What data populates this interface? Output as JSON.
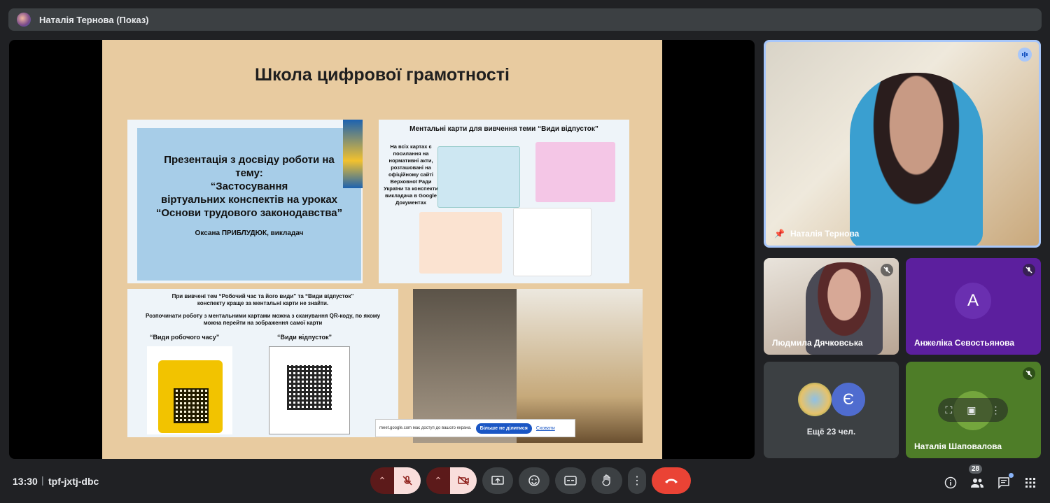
{
  "top_bar": {
    "presenter_label": "Наталія Тернова (Показ)"
  },
  "slide": {
    "title": "Школа цифрової грамотності",
    "panel1": {
      "lines": [
        "Презентація з досвіду  роботи на",
        "тему:",
        "“Застосування",
        "віртуальних конспектів на уроках",
        "“Основи трудового законодавства”"
      ],
      "author": "Оксана ПРИБЛУДЮК, викладач"
    },
    "panel2": {
      "heading": "Ментальні карти для вивчення теми “Види відпусток”",
      "note": "На всіх картах є посилання на нормативні акти, розташовані на офіційному сайті Верховної Ради України  та конспекти викладача в Google Документах"
    },
    "panel3": {
      "line1": "При вивчені тем “Робочий час та його види” та “Види відпусток”",
      "line2": "конспекту краще за ментальні карти не знайти.",
      "line3": "Розпочинати роботу з ментальними картами можна з сканування QR-коду, по якому",
      "line4": "можна перейти на зображення самої карти",
      "label_left": "“Види робочого часу”",
      "label_right": "“Види відпусток”"
    },
    "share_banner": {
      "text": "meet.google.com має доступ до вашого екрана.",
      "stop_button": "Більше не ділитися",
      "hide_link": "Сховати"
    }
  },
  "participants": {
    "main": {
      "name": "Наталія Тернова"
    },
    "tile2": {
      "name": "Людмила Дячковська"
    },
    "tile3": {
      "name": "Анжеліка Севостьянова",
      "initial": "А"
    },
    "tile4": {
      "more": "Ещё 23 чел.",
      "initial": "Є"
    },
    "tile5": {
      "name": "Наталія Шаповалова"
    }
  },
  "bottom_bar": {
    "time": "13:30",
    "separator": "|",
    "meeting_code": "tpf-jxtj-dbc",
    "participants_count": "28"
  },
  "colors": {
    "hangup": "#ea4335",
    "active_border": "#a8c7fa",
    "background": "#202124"
  }
}
